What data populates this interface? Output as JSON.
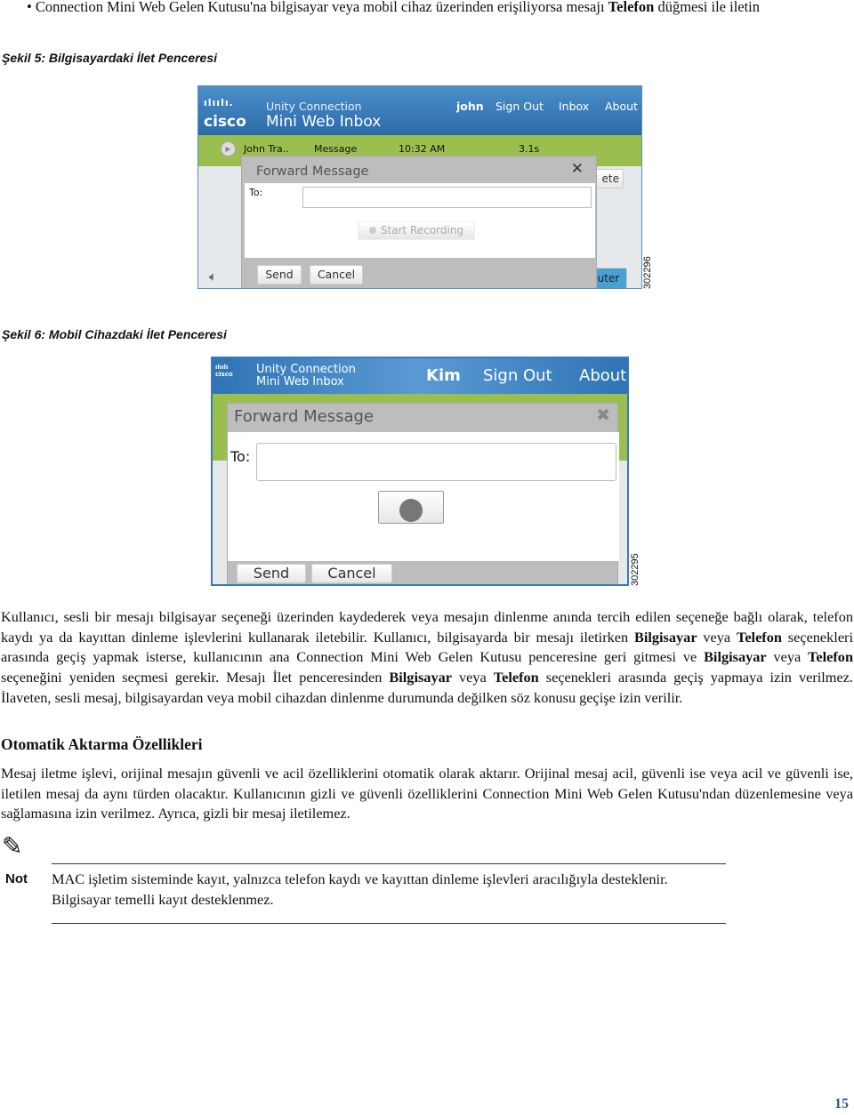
{
  "top_bullet": {
    "text_before": "Connection Mini Web Gelen Kutusu'na bilgisayar veya mobil cihaz üzerinden erişiliyorsa mesajı ",
    "bold": "Telefon",
    "text_after": " düğmesi ile iletin"
  },
  "figure5": {
    "caption": "Şekil 5: Bilgisayardaki İlet Penceresi",
    "figure_id": "302296",
    "header": {
      "brand": "cisco",
      "product_line1": "Unity Connection",
      "product_line2": "Mini Web Inbox",
      "user": "john",
      "sign_out": "Sign Out",
      "inbox": "Inbox",
      "about": "About"
    },
    "message_row": {
      "sender": "John Tra..",
      "type": "Message",
      "time": "10:32 AM",
      "duration": "3.1s"
    },
    "behind_button_partial": "ete",
    "behind_bottom_partial": "uter",
    "dialog": {
      "title": "Forward Message",
      "close": "✕",
      "to_label": "To:",
      "to_value": "",
      "record_button": "Start Recording",
      "send": "Send",
      "cancel": "Cancel"
    }
  },
  "figure6": {
    "caption": "Şekil 6: Mobil Cihazdaki İlet Penceresi",
    "figure_id": "302295",
    "header": {
      "brand": "cisco",
      "product_line1": "Unity Connection",
      "product_line2": "Mini Web Inbox",
      "user": "Kim",
      "sign_out": "Sign Out",
      "about": "About"
    },
    "dialog": {
      "title": "Forward Message",
      "close": "✖",
      "to_label": "To:",
      "to_value": "",
      "send": "Send",
      "cancel": "Cancel"
    }
  },
  "para1": [
    {
      "t": "Kullanıcı, sesli bir mesajı bilgisayar seçeneği üzerinden kaydederek veya mesajın dinlenme anında tercih edilen seçeneğe bağlı olarak, telefon kaydı ya da kayıttan dinleme işlevlerini kullanarak iletebilir. Kullanıcı, bilgisayarda bir mesajı iletirken "
    },
    {
      "b": "Bilgisayar"
    },
    {
      "t": " veya "
    },
    {
      "b": "Telefon"
    },
    {
      "t": " seçenekleri arasında geçiş yapmak isterse, kullanıcının ana Connection Mini Web Gelen Kutusu penceresine geri gitmesi ve "
    },
    {
      "b": "Bilgisayar"
    },
    {
      "t": " veya "
    },
    {
      "b": "Telefon"
    },
    {
      "t": " seçeneğini yeniden seçmesi gerekir. Mesajı İlet penceresinden "
    },
    {
      "b": "Bilgisayar"
    },
    {
      "t": " veya "
    },
    {
      "b": "Telefon"
    },
    {
      "t": " seçenekleri arasında geçiş yapmaya izin verilmez. İlaveten, sesli mesaj, bilgisayardan veya mobil cihazdan dinlenme durumunda değilken söz konusu geçişe izin verilir."
    }
  ],
  "heading": "Otomatik Aktarma Özellikleri",
  "para2": "Mesaj iletme işlevi, orijinal mesajın güvenli ve acil özelliklerini otomatik olarak aktarır. Orijinal mesaj acil, güvenli ise veya acil ve güvenli ise, iletilen mesaj da aynı türden olacaktır. Kullanıcının gizli ve güvenli özelliklerini Connection Mini Web Gelen Kutusu'ndan düzenlemesine veya sağlamasına izin verilmez. Ayrıca, gizli bir mesaj iletilemez.",
  "note": {
    "label": "Not",
    "icon": "pencil-note-icon",
    "text": "MAC işletim sisteminde kayıt, yalnızca telefon kaydı ve kayıttan dinleme işlevleri aracılığıyla desteklenir. Bilgisayar temelli kayıt desteklenmez."
  },
  "page_number": "15"
}
